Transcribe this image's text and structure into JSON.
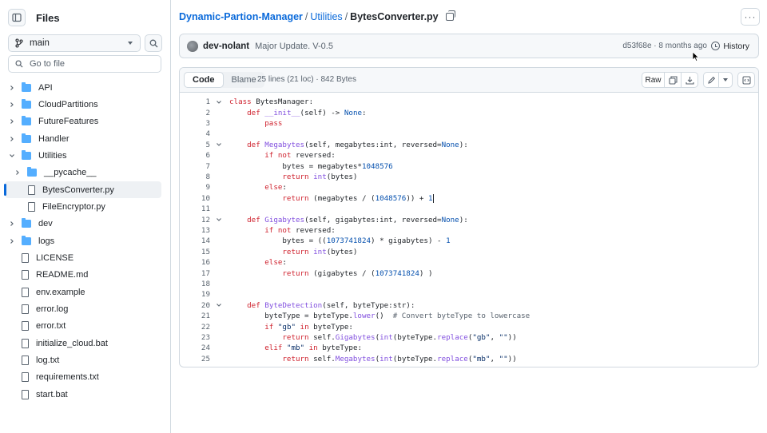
{
  "sidebar": {
    "title": "Files",
    "branch": "main",
    "goto_placeholder": "Go to file",
    "tree": [
      {
        "label": "API",
        "type": "folder",
        "expanded": false,
        "depth": 0
      },
      {
        "label": "CloudPartitions",
        "type": "folder",
        "expanded": false,
        "depth": 0
      },
      {
        "label": "FutureFeatures",
        "type": "folder",
        "expanded": false,
        "depth": 0
      },
      {
        "label": "Handler",
        "type": "folder",
        "expanded": false,
        "depth": 0
      },
      {
        "label": "Utilities",
        "type": "folder",
        "expanded": true,
        "depth": 0
      },
      {
        "label": "__pycache__",
        "type": "folder",
        "expanded": false,
        "depth": 1
      },
      {
        "label": "BytesConverter.py",
        "type": "file",
        "depth": 1,
        "selected": true
      },
      {
        "label": "FileEncryptor.py",
        "type": "file",
        "depth": 1
      },
      {
        "label": "dev",
        "type": "folder",
        "expanded": false,
        "depth": 0
      },
      {
        "label": "logs",
        "type": "folder",
        "expanded": false,
        "depth": 0
      },
      {
        "label": "LICENSE",
        "type": "file",
        "depth": 0
      },
      {
        "label": "README.md",
        "type": "file",
        "depth": 0
      },
      {
        "label": "env.example",
        "type": "file",
        "depth": 0
      },
      {
        "label": "error.log",
        "type": "file",
        "depth": 0
      },
      {
        "label": "error.txt",
        "type": "file",
        "depth": 0
      },
      {
        "label": "initialize_cloud.bat",
        "type": "file",
        "depth": 0
      },
      {
        "label": "log.txt",
        "type": "file",
        "depth": 0
      },
      {
        "label": "requirements.txt",
        "type": "file",
        "depth": 0
      },
      {
        "label": "start.bat",
        "type": "file",
        "depth": 0
      }
    ]
  },
  "breadcrumb": {
    "repo": "Dynamic-Partion-Manager",
    "folder": "Utilities",
    "sep": "/",
    "file": "BytesConverter.py"
  },
  "more_label": "···",
  "commit": {
    "author": "dev-nolant",
    "message": "Major Update. V-0.5",
    "meta": "d53f68e · 8 months ago",
    "history": "History"
  },
  "toolbar": {
    "code_tab": "Code",
    "blame_tab": "Blame",
    "file_info": "25 lines (21 loc) · 842 Bytes",
    "raw": "Raw"
  },
  "code_lines": [
    {
      "n": "1",
      "fold": true
    },
    {
      "n": "2",
      "fold": false
    },
    {
      "n": "3",
      "fold": false
    },
    {
      "n": "4",
      "fold": false
    },
    {
      "n": "5",
      "fold": true
    },
    {
      "n": "6",
      "fold": false
    },
    {
      "n": "7",
      "fold": false
    },
    {
      "n": "8",
      "fold": false
    },
    {
      "n": "9",
      "fold": false
    },
    {
      "n": "10",
      "fold": false
    },
    {
      "n": "11",
      "fold": false
    },
    {
      "n": "12",
      "fold": true
    },
    {
      "n": "13",
      "fold": false
    },
    {
      "n": "14",
      "fold": false
    },
    {
      "n": "15",
      "fold": false
    },
    {
      "n": "16",
      "fold": false
    },
    {
      "n": "17",
      "fold": false
    },
    {
      "n": "18",
      "fold": false
    },
    {
      "n": "19",
      "fold": false
    },
    {
      "n": "20",
      "fold": true
    },
    {
      "n": "21",
      "fold": false
    },
    {
      "n": "22",
      "fold": false
    },
    {
      "n": "23",
      "fold": false
    },
    {
      "n": "24",
      "fold": false
    },
    {
      "n": "25",
      "fold": false
    }
  ],
  "code_tokens": [
    [
      [
        "kw",
        "class "
      ],
      [
        "",
        "BytesManager:"
      ]
    ],
    [
      [
        "",
        "    "
      ],
      [
        "kw",
        "def "
      ],
      [
        "fn",
        "__init__"
      ],
      [
        "",
        "(self) -> "
      ],
      [
        "num",
        "None"
      ],
      [
        "",
        ":"
      ]
    ],
    [
      [
        "",
        "        "
      ],
      [
        "kw",
        "pass"
      ]
    ],
    [],
    [
      [
        "",
        "    "
      ],
      [
        "kw",
        "def "
      ],
      [
        "fn",
        "Megabytes"
      ],
      [
        "",
        "(self, megabytes:int, reversed="
      ],
      [
        "num",
        "None"
      ],
      [
        "",
        "):"
      ]
    ],
    [
      [
        "",
        "        "
      ],
      [
        "kw",
        "if not "
      ],
      [
        "",
        "reversed:"
      ]
    ],
    [
      [
        "",
        "            bytes = megabytes*"
      ],
      [
        "num",
        "1048576"
      ]
    ],
    [
      [
        "",
        "            "
      ],
      [
        "kw",
        "return "
      ],
      [
        "fn",
        "int"
      ],
      [
        "",
        "(bytes)"
      ]
    ],
    [
      [
        "",
        "        "
      ],
      [
        "kw",
        "else"
      ],
      [
        "",
        ":"
      ]
    ],
    [
      [
        "",
        "            "
      ],
      [
        "kw",
        "return "
      ],
      [
        "",
        "(megabytes / ("
      ],
      [
        "num",
        "1048576"
      ],
      [
        "",
        ")) + "
      ],
      [
        "num",
        "1"
      ]
    ],
    [],
    [
      [
        "",
        "    "
      ],
      [
        "kw",
        "def "
      ],
      [
        "fn",
        "Gigabytes"
      ],
      [
        "",
        "(self, gigabytes:int, reversed="
      ],
      [
        "num",
        "None"
      ],
      [
        "",
        "):"
      ]
    ],
    [
      [
        "",
        "        "
      ],
      [
        "kw",
        "if not "
      ],
      [
        "",
        "reversed:"
      ]
    ],
    [
      [
        "",
        "            bytes = (("
      ],
      [
        "num",
        "1073741824"
      ],
      [
        "",
        ") * gigabytes) - "
      ],
      [
        "num",
        "1"
      ]
    ],
    [
      [
        "",
        "            "
      ],
      [
        "kw",
        "return "
      ],
      [
        "fn",
        "int"
      ],
      [
        "",
        "(bytes)"
      ]
    ],
    [
      [
        "",
        "        "
      ],
      [
        "kw",
        "else"
      ],
      [
        "",
        ":"
      ]
    ],
    [
      [
        "",
        "            "
      ],
      [
        "kw",
        "return "
      ],
      [
        "",
        "(gigabytes / ("
      ],
      [
        "num",
        "1073741824"
      ],
      [
        "",
        ") )"
      ]
    ],
    [],
    [],
    [
      [
        "",
        "    "
      ],
      [
        "kw",
        "def "
      ],
      [
        "fn",
        "ByteDetection"
      ],
      [
        "",
        "(self, byteType:str):"
      ]
    ],
    [
      [
        "",
        "        byteType = byteType."
      ],
      [
        "fn",
        "lower"
      ],
      [
        "",
        "()  "
      ],
      [
        "cm",
        "# Convert byteType to lowercase"
      ]
    ],
    [
      [
        "",
        "        "
      ],
      [
        "kw",
        "if "
      ],
      [
        "str",
        "\"gb\""
      ],
      [
        "kw",
        " in "
      ],
      [
        "",
        "byteType:"
      ]
    ],
    [
      [
        "",
        "            "
      ],
      [
        "kw",
        "return "
      ],
      [
        "",
        "self."
      ],
      [
        "fn",
        "Gigabytes"
      ],
      [
        "",
        "("
      ],
      [
        "fn",
        "int"
      ],
      [
        "",
        "(byteType."
      ],
      [
        "fn",
        "replace"
      ],
      [
        "",
        "("
      ],
      [
        "str",
        "\"gb\""
      ],
      [
        "",
        ", "
      ],
      [
        "str",
        "\"\""
      ],
      [
        "",
        "))"
      ]
    ],
    [
      [
        "",
        "        "
      ],
      [
        "kw",
        "elif "
      ],
      [
        "str",
        "\"mb\""
      ],
      [
        "kw",
        " in "
      ],
      [
        "",
        "byteType:"
      ]
    ],
    [
      [
        "",
        "            "
      ],
      [
        "kw",
        "return "
      ],
      [
        "",
        "self."
      ],
      [
        "fn",
        "Megabytes"
      ],
      [
        "",
        "("
      ],
      [
        "fn",
        "int"
      ],
      [
        "",
        "(byteType."
      ],
      [
        "fn",
        "replace"
      ],
      [
        "",
        "("
      ],
      [
        "str",
        "\"mb\""
      ],
      [
        "",
        ", "
      ],
      [
        "str",
        "\"\""
      ],
      [
        "",
        "))"
      ]
    ]
  ],
  "icons": {
    "sidebar_toggle": "sidebar-collapse-icon",
    "branch": "git-branch-icon",
    "search": "search-icon",
    "copy": "copy-icon",
    "history": "history-icon",
    "copy_raw": "copy-icon",
    "download": "download-icon",
    "edit": "pencil-icon",
    "symbols": "code-square-icon"
  },
  "colors": {
    "accent": "#0969da",
    "folder": "#54aeff",
    "keyword": "#cf222e",
    "function": "#8250df",
    "constant": "#0550ae",
    "string": "#0a3069"
  }
}
